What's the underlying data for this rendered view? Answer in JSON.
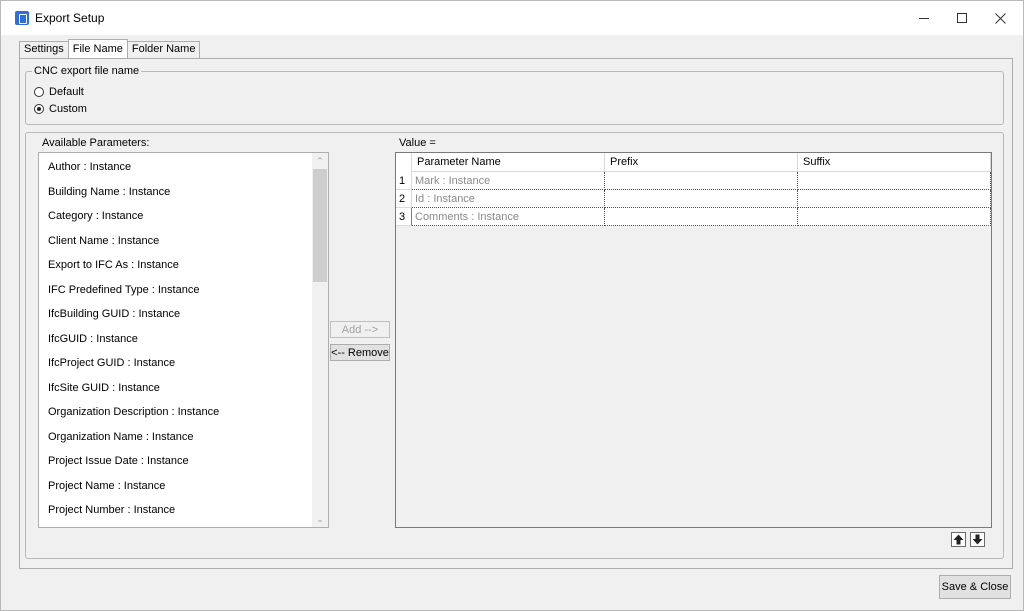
{
  "window": {
    "title": "Export Setup"
  },
  "tabs": [
    {
      "label": "Settings",
      "active": false
    },
    {
      "label": "File Name",
      "active": true
    },
    {
      "label": "Folder Name",
      "active": false
    }
  ],
  "cnc_group": {
    "legend": "CNC export file name",
    "options": [
      {
        "label": "Default",
        "checked": false
      },
      {
        "label": "Custom",
        "checked": true
      }
    ]
  },
  "available": {
    "label": "Available Parameters:",
    "items": [
      "Author : Instance",
      "Building Name : Instance",
      "Category : Instance",
      "Client Name : Instance",
      "Export to IFC As : Instance",
      "IFC Predefined Type : Instance",
      "IfcBuilding GUID : Instance",
      "IfcGUID : Instance",
      "IfcProject GUID : Instance",
      "IfcSite GUID : Instance",
      "Organization Description : Instance",
      "Organization Name : Instance",
      "Project Issue Date : Instance",
      "Project Name : Instance",
      "Project Number : Instance"
    ]
  },
  "buttons": {
    "add": "Add -->",
    "remove": "<-- Remove",
    "save_close": "Save & Close"
  },
  "value": {
    "label": "Value =",
    "columns": [
      "Parameter Name",
      "Prefix",
      "Suffix"
    ],
    "rows": [
      {
        "num": "1",
        "parameter": "Mark : Instance",
        "prefix": "",
        "suffix": ""
      },
      {
        "num": "2",
        "parameter": "Id : Instance",
        "prefix": "",
        "suffix": ""
      },
      {
        "num": "3",
        "parameter": "Comments : Instance",
        "prefix": "",
        "suffix": ""
      }
    ]
  },
  "icons": {
    "move_up": "arrow-up-icon",
    "move_down": "arrow-down-icon"
  }
}
